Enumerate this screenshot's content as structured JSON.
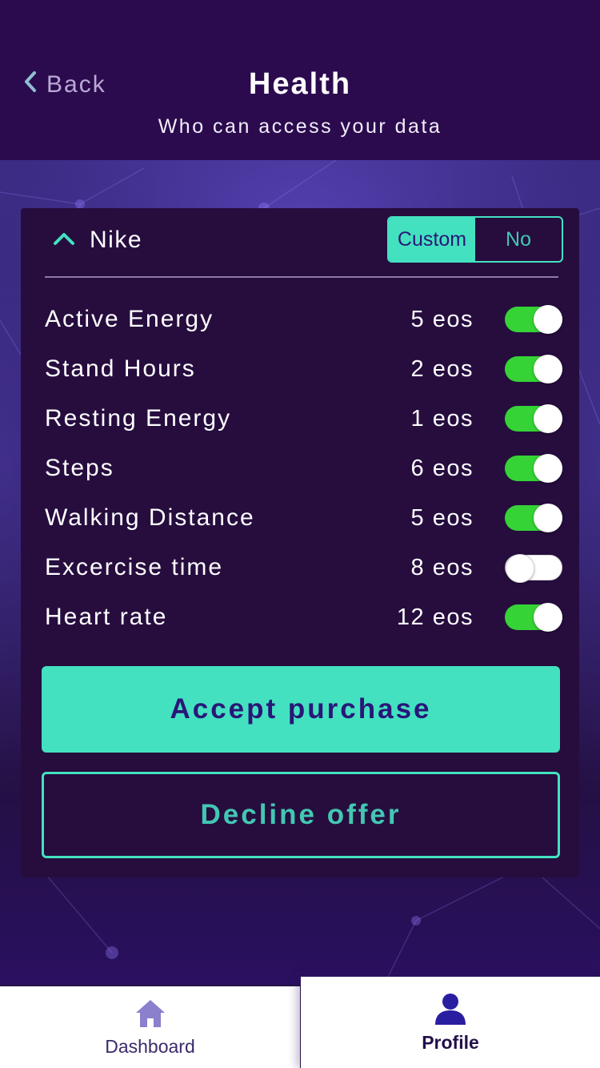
{
  "header": {
    "back_label": "Back",
    "title": "Health",
    "subtitle": "Who can access your data"
  },
  "card": {
    "company": "Nike",
    "expanded": true,
    "segment": {
      "options": [
        "Custom",
        "No"
      ],
      "selected": "Custom"
    },
    "items": [
      {
        "label": "Active Energy",
        "value": "5 eos",
        "enabled": true
      },
      {
        "label": "Stand Hours",
        "value": "2 eos",
        "enabled": true
      },
      {
        "label": "Resting Energy",
        "value": "1 eos",
        "enabled": true
      },
      {
        "label": "Steps",
        "value": "6 eos",
        "enabled": true
      },
      {
        "label": "Walking Distance",
        "value": "5 eos",
        "enabled": true
      },
      {
        "label": "Excercise time",
        "value": "8 eos",
        "enabled": false
      },
      {
        "label": "Heart rate",
        "value": "12 eos",
        "enabled": true
      }
    ],
    "accept_label": "Accept purchase",
    "decline_label": "Decline offer"
  },
  "tabbar": {
    "items": [
      {
        "label": "Dashboard",
        "icon": "home-icon",
        "active": false
      },
      {
        "label": "Profile",
        "icon": "user-icon",
        "active": true
      }
    ]
  },
  "colors": {
    "header_bg": "#2b0b4e",
    "panel_bg": "#260d3e",
    "accent": "#43e1c0",
    "accent_text": "#2a1678",
    "toggle_on": "#35d335",
    "tab_icon_inactive": "#8a80cc",
    "tab_icon_active": "#2a1ea0"
  }
}
